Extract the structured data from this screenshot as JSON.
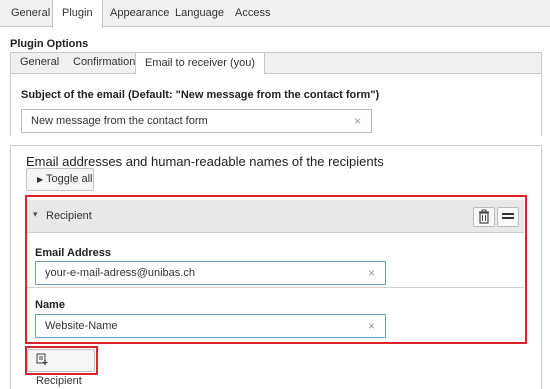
{
  "top_tabs": [
    "General",
    "Plugin",
    "Appearance",
    "Language",
    "Access"
  ],
  "section_title": "Plugin Options",
  "sub_tabs": [
    "General",
    "Confirmation",
    "Email to receiver (you)"
  ],
  "subject": {
    "label": "Subject of the email (Default: \"New message from the contact form\")",
    "value": "New message from the contact form",
    "clear": "×"
  },
  "recipients": {
    "title": "Email addresses and human-readable names of the recipients",
    "toggle_label": "Toggle all",
    "toggle_icon": "▶",
    "item": {
      "header_label": "Recipient",
      "caret": "▾",
      "email_label": "Email Address",
      "email_value": "your-e-mail-adress@unibas.ch",
      "name_label": "Name",
      "name_value": "Website-Name",
      "clear": "×"
    },
    "add_label": "Recipient"
  },
  "colors": {
    "highlight": "#d9232d",
    "active_input_border": "#6ea3cf"
  }
}
